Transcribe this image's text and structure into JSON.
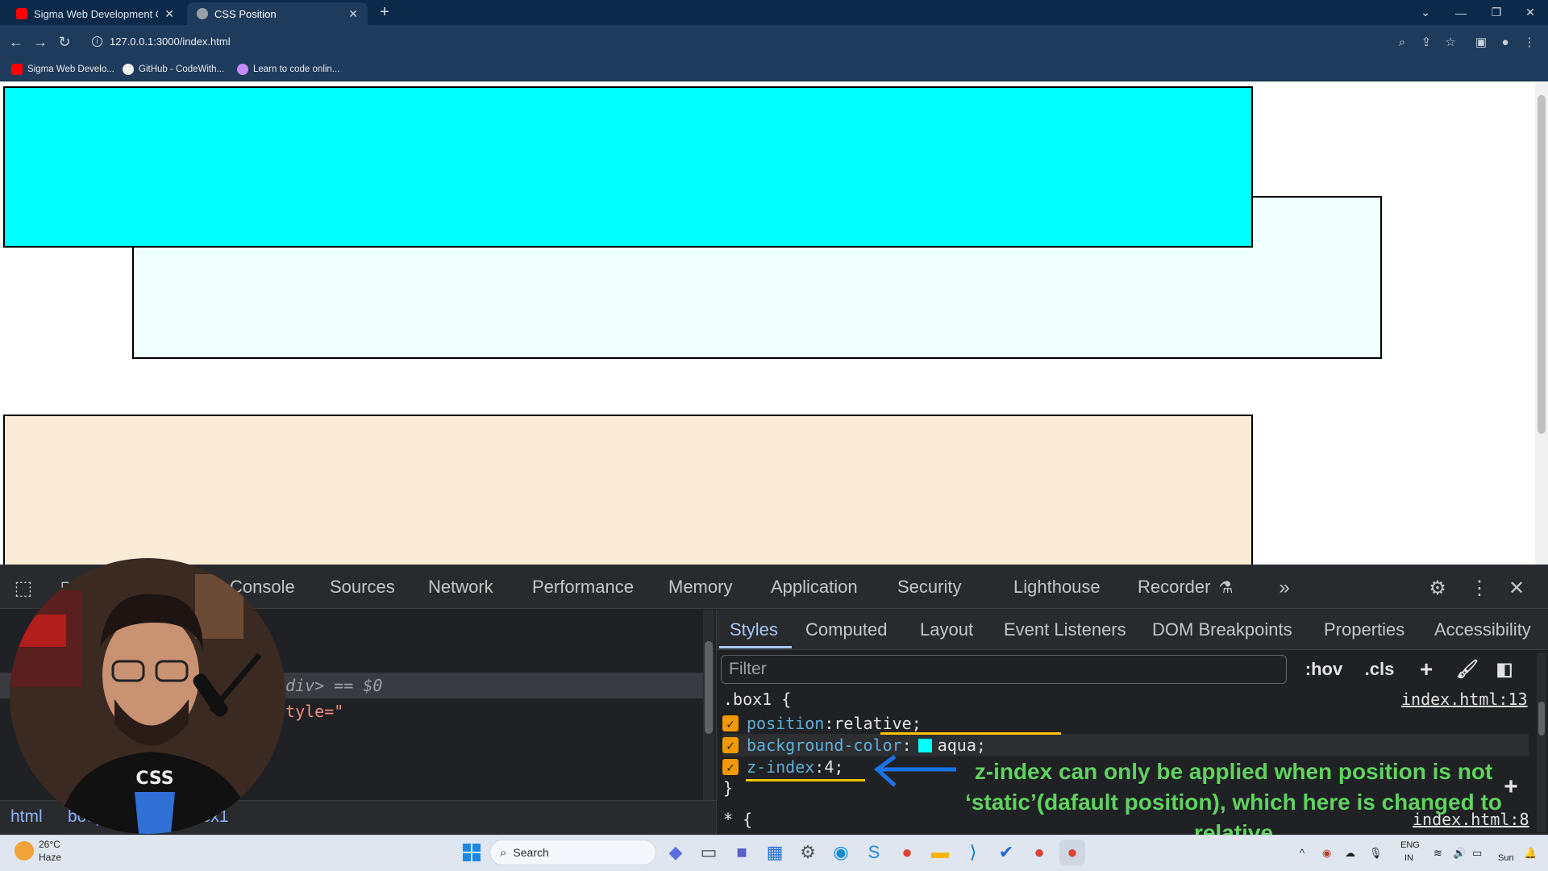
{
  "browser": {
    "tabs": [
      {
        "title": "Sigma Web Development Cours",
        "favicon": "youtube-icon",
        "active": false
      },
      {
        "title": "CSS Position",
        "favicon": "globe-icon",
        "active": true
      }
    ],
    "url": "127.0.0.1:3000/index.html",
    "bookmarks": [
      {
        "label": "Sigma Web Develo...",
        "icon": "youtube-icon"
      },
      {
        "label": "GitHub - CodeWith...",
        "icon": "github-icon"
      },
      {
        "label": "Learn to code onlin...",
        "icon": "codepen-icon"
      }
    ]
  },
  "page": {
    "boxes": [
      {
        "name": "box1",
        "color": "#00ffff"
      },
      {
        "name": "box2",
        "color": "#f0ffff"
      },
      {
        "name": "box3",
        "color": "#faebd7"
      }
    ]
  },
  "devtools": {
    "tabs": [
      "Console",
      "Sources",
      "Network",
      "Performance",
      "Memory",
      "Application",
      "Security",
      "Lighthouse",
      "Recorder"
    ],
    "elements": {
      "selected_line": "/div> == $0",
      "next_line": "style=\"",
      "breadcrumb": [
        "html",
        "body",
        "box1"
      ]
    },
    "styles": {
      "tabs": [
        "Styles",
        "Computed",
        "Layout",
        "Event Listeners",
        "DOM Breakpoints",
        "Properties",
        "Accessibility"
      ],
      "filter_placeholder": "Filter",
      "buttons": [
        ":hov",
        ".cls"
      ],
      "rule": {
        "selector": ".box1 {",
        "source": "index.html:13",
        "declarations": [
          {
            "prop": "position",
            "value": "relative;"
          },
          {
            "prop": "background-color",
            "value": "aqua;",
            "swatch": "#00ffff"
          },
          {
            "prop": "z-index",
            "value": "4;"
          }
        ],
        "close": "}"
      },
      "next_rule": {
        "selector": "* {",
        "source": "index.html:8"
      }
    },
    "annotation": "z-index can only be applied when position is not ‘static’(dafault position), which here is changed to relative"
  },
  "taskbar": {
    "weather_temp": "26°C",
    "weather_desc": "Haze",
    "search_label": "Search",
    "lang": "ENG",
    "region": "IN",
    "day": "Sun"
  }
}
